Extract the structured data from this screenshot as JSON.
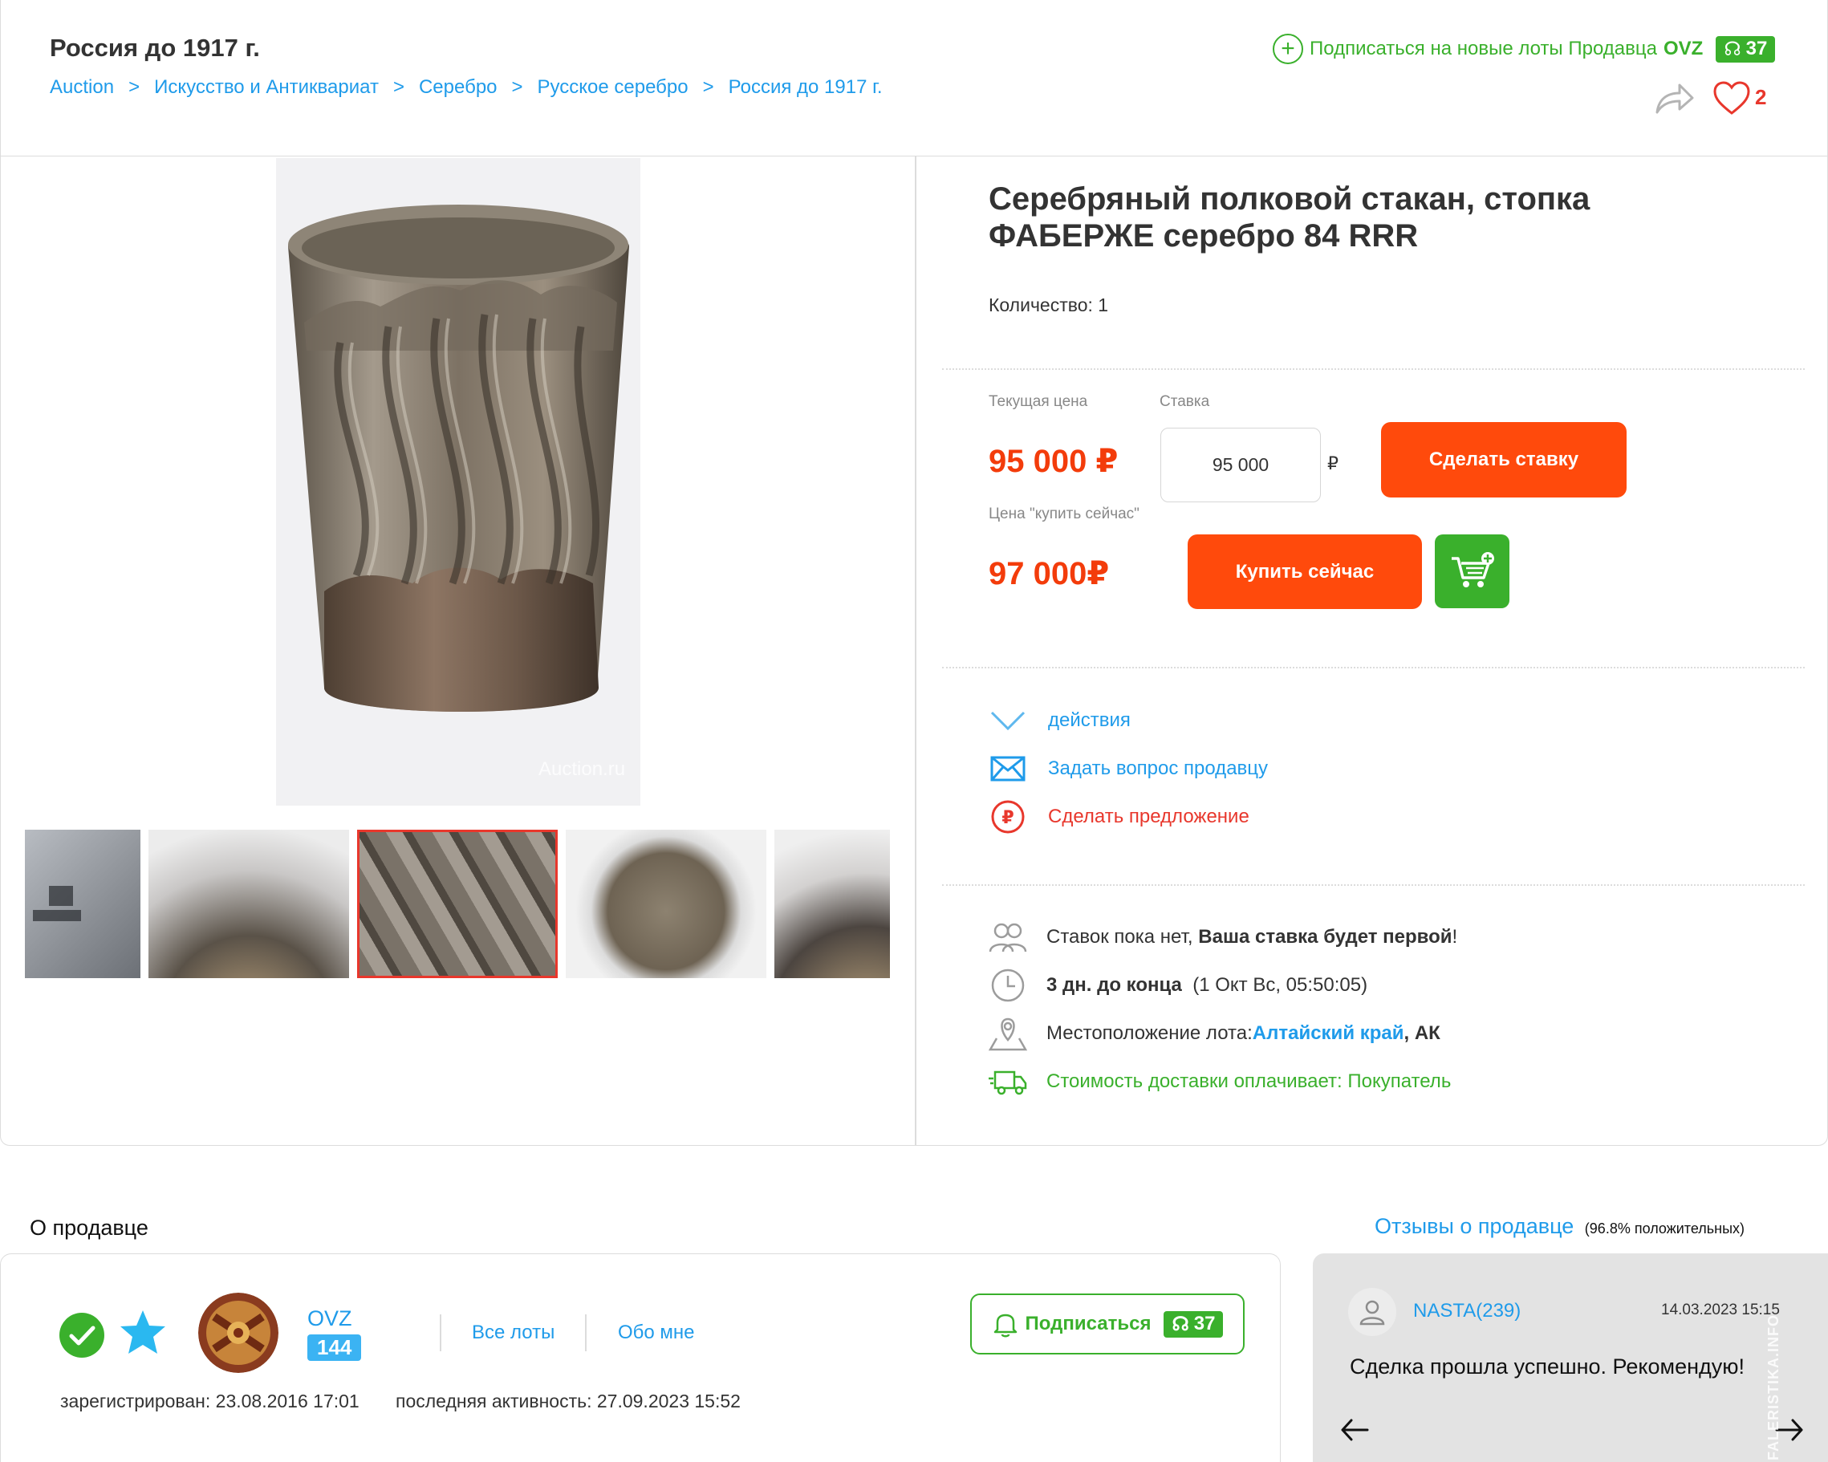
{
  "header": {
    "title": "Россия до 1917 г.",
    "breadcrumb": [
      "Auction",
      "Искусство и Антиквариат",
      "Серебро",
      "Русское серебро",
      "Россия до 1917 г."
    ],
    "breadcrumb_separator": ">",
    "subscribe_text": "Подписаться на новые лоты Продавца",
    "subscribe_seller": "OVZ",
    "subscribers_count": "37",
    "favorites_count": "2"
  },
  "gallery": {
    "watermark": "Auction.ru",
    "thumbnails": [
      {
        "name": "thumb-hallmark",
        "active": false
      },
      {
        "name": "thumb-inside",
        "active": false
      },
      {
        "name": "thumb-side",
        "active": true
      },
      {
        "name": "thumb-bottom",
        "active": false
      },
      {
        "name": "thumb-inside-2",
        "active": false
      }
    ]
  },
  "product": {
    "title": "Серебряный полковой стакан, стопка ФАБЕРЖЕ серебро 84 RRR",
    "quantity": "Количество: 1"
  },
  "pricing": {
    "current_price_label": "Текущая цена",
    "current_price": "95 000 ₽",
    "bid_label": "Ставка",
    "bid_value": "95 000",
    "currency": "₽",
    "bid_button": "Сделать ставку",
    "buy_now_label": "Цена \"купить сейчас\"",
    "buy_now_price": "97 000₽",
    "buy_now_button": "Купить сейчас"
  },
  "actions": {
    "more": "действия",
    "ask_seller": "Задать вопрос продавцу",
    "make_offer": "Сделать предложение"
  },
  "lot_info": {
    "bids_text": "Ставок пока нет,",
    "bids_bold": "Ваша ставка будет первой",
    "bids_end": "!",
    "time_bold": "3 дн. до конца",
    "time_rest": "(1 Окт Вс, 05:50:05)",
    "location_label": "Местоположение лота:",
    "location_region": "Алтайский край",
    "location_code": ", АК",
    "delivery": "Стоимость доставки оплачивает: Покупатель"
  },
  "seller": {
    "heading": "О продавце",
    "name": "OVZ",
    "rating": "144",
    "all_lots": "Все лоты",
    "about": "Обо мне",
    "subscribe_button": "Подписаться",
    "subscribers": "37",
    "registered": "зарегистрирован: 23.08.2016 17:01",
    "last_active": "последняя активность: 27.09.2023 15:52"
  },
  "reviews": {
    "heading": "Отзывы о продавце",
    "positive": "(96.8% положительных)",
    "reviewer": "NASTA(239)",
    "date": "14.03.2023 15:15",
    "text": "Сделка прошла успешно. Рекомендую!",
    "site_watermark": "FALERISTIKA.INFO"
  },
  "colors": {
    "accent_blue": "#1f9bea",
    "action_red": "#ff4a0c",
    "price_red": "#f33c0b",
    "green": "#3ab02c"
  }
}
